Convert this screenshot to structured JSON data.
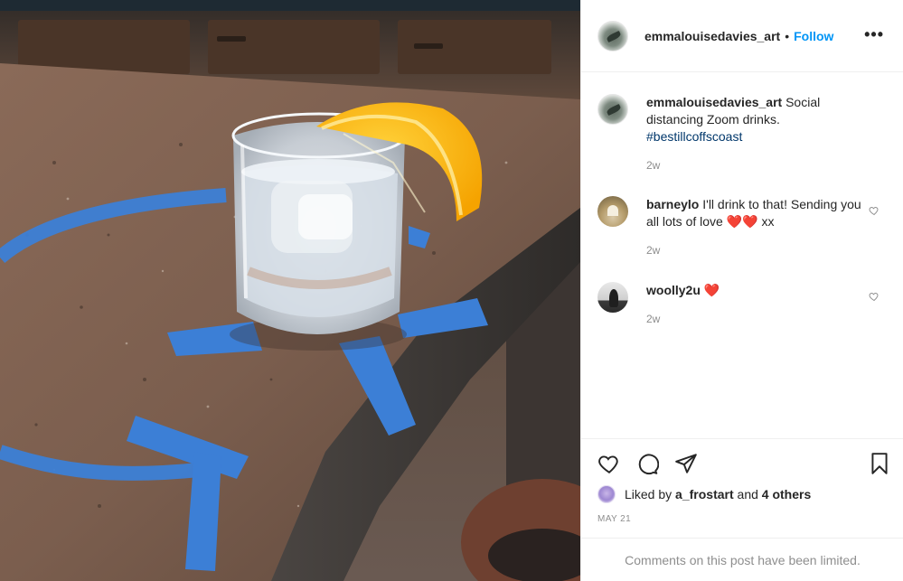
{
  "post": {
    "author": "emmalouisedavies_art",
    "dot": "•",
    "follow_label": "Follow",
    "more_label": "•••",
    "caption_text": "Social distancing Zoom drinks.",
    "hashtag": "#bestillcoffscoast",
    "caption_time": "2w"
  },
  "comments": [
    {
      "user": "barneylo",
      "text": "I'll drink to that! Sending you all lots of love ❤️❤️ xx",
      "time": "2w"
    },
    {
      "user": "woolly2u",
      "text": "❤️",
      "time": "2w"
    }
  ],
  "likes": {
    "prefix": "Liked by",
    "user": "a_frostart",
    "connector": "and",
    "others": "4 others"
  },
  "date": "MAY 21",
  "comments_limited": "Comments on this post have been limited.",
  "icons": [
    "heart-icon",
    "comment-icon",
    "share-icon",
    "bookmark-icon"
  ],
  "colors": {
    "follow": "#0095f6",
    "hashtag": "#00376b",
    "muted": "#8e8e8e"
  }
}
